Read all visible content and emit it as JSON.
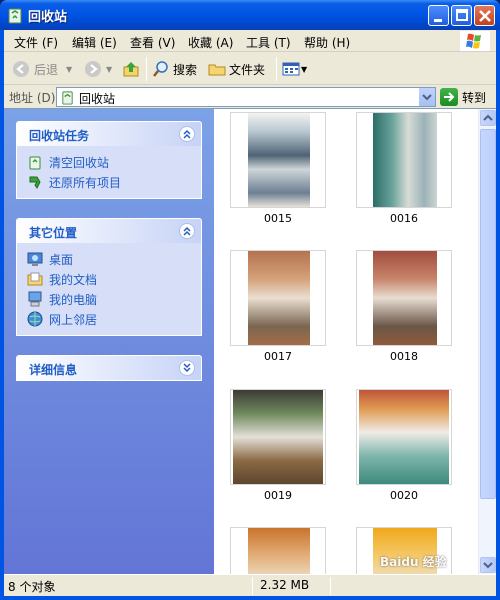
{
  "window": {
    "title": "回收站"
  },
  "menu": [
    {
      "label": "文件 (F)"
    },
    {
      "label": "编辑 (E)"
    },
    {
      "label": "查看 (V)"
    },
    {
      "label": "收藏 (A)"
    },
    {
      "label": "工具 (T)"
    },
    {
      "label": "帮助 (H)"
    }
  ],
  "toolbar": {
    "back": "后退",
    "search": "搜索",
    "folders": "文件夹"
  },
  "address": {
    "label": "地址 (D)",
    "value": "回收站",
    "go": "转到"
  },
  "tasks": {
    "title": "回收站任务",
    "items": [
      {
        "label": "清空回收站"
      },
      {
        "label": "还原所有项目"
      }
    ]
  },
  "places": {
    "title": "其它位置",
    "items": [
      {
        "label": "桌面"
      },
      {
        "label": "我的文档"
      },
      {
        "label": "我的电脑"
      },
      {
        "label": "网上邻居"
      }
    ]
  },
  "details": {
    "title": "详细信息"
  },
  "files": [
    {
      "name": "0015"
    },
    {
      "name": "0016"
    },
    {
      "name": "0017"
    },
    {
      "name": "0018"
    },
    {
      "name": "0019"
    },
    {
      "name": "0020"
    },
    {
      "name": ""
    },
    {
      "name": ""
    }
  ],
  "status": {
    "count": "8 个对象",
    "size": "2.32 MB"
  },
  "watermark": "Baidu 经验",
  "colors": {
    "title_bar": "#0054e3",
    "task_pane": "#6f8cde",
    "link": "#215dc6"
  }
}
